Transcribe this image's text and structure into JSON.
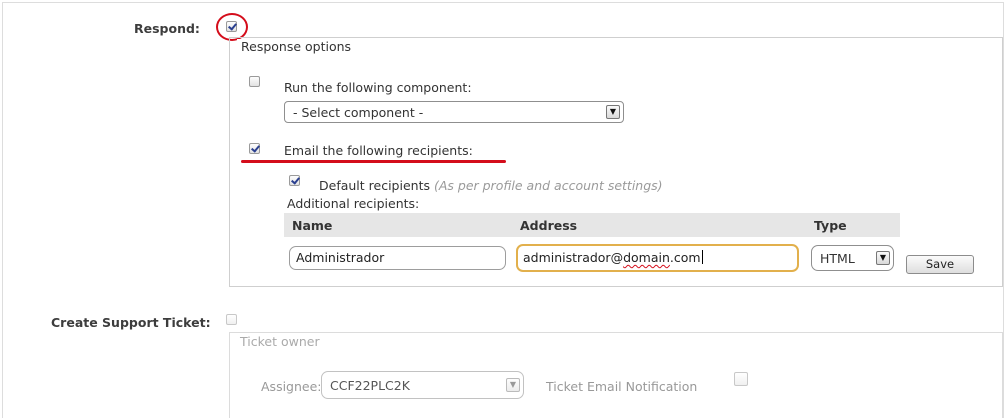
{
  "respond": {
    "label": "Respond:",
    "checked": true,
    "response_options": {
      "legend": "Response options",
      "run_component": {
        "label": "Run the following component:",
        "checked": false,
        "select_value": "- Select component -"
      },
      "email_recipients": {
        "label": "Email the following recipients:",
        "checked": true,
        "default_recipients": {
          "label": "Default recipients",
          "hint": "(As per profile and account settings)",
          "checked": true
        },
        "additional_label": "Additional recipients:",
        "columns": {
          "name": "Name",
          "address": "Address",
          "type": "Type"
        },
        "row": {
          "name_value": "Administrador",
          "address_prefix": "administrador@",
          "address_domain": "domain",
          "address_suffix": ".com",
          "type_value": "HTML"
        },
        "save_label": "Save"
      }
    }
  },
  "support_ticket": {
    "label": "Create Support Ticket:",
    "checked": false,
    "ticket_owner": {
      "legend": "Ticket owner",
      "assignee_label": "Assignee:",
      "assignee_value": "CCF22PLC2K",
      "notification_label": "Ticket Email Notification",
      "notification_checked": false
    }
  },
  "colors": {
    "annotation_red": "#d40d1b",
    "focus_border": "#e2b04c",
    "header_bg": "#e6e6e6"
  }
}
